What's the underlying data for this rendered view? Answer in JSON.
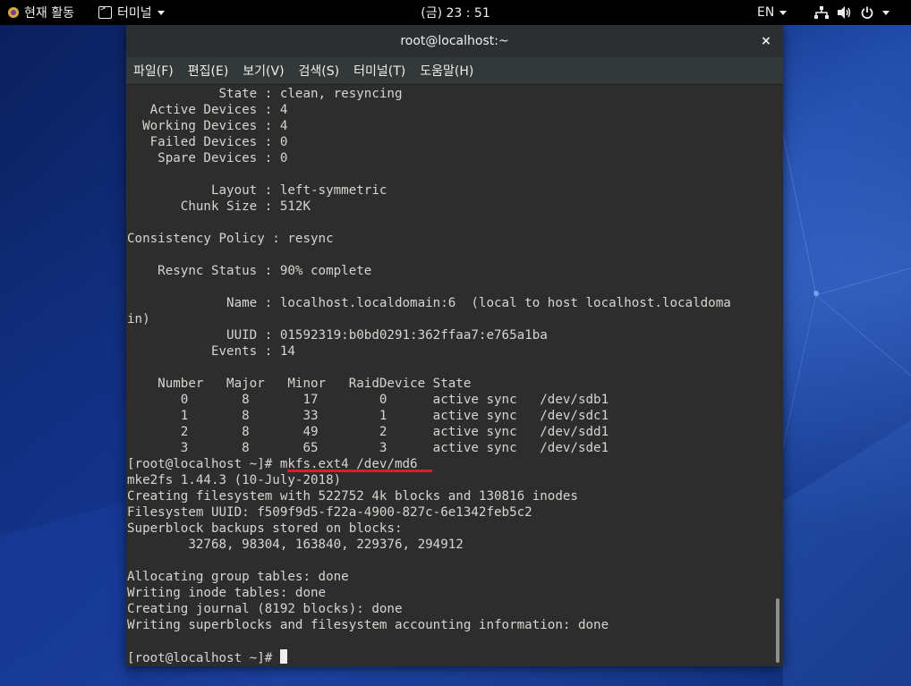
{
  "topbar": {
    "activities_label": "현재 활동",
    "app_menu_label": "터미널",
    "clock": "(금) 23 : 51",
    "input_method": "EN"
  },
  "window": {
    "title": "root@localhost:~",
    "close_symbol": "×"
  },
  "menu": [
    {
      "label": "파일(F)"
    },
    {
      "label": "편집(E)"
    },
    {
      "label": "보기(V)"
    },
    {
      "label": "검색(S)"
    },
    {
      "label": "터미널(T)"
    },
    {
      "label": "도움말(H)"
    }
  ],
  "terminal": {
    "lines": [
      "            State : clean, resyncing",
      "   Active Devices : 4",
      "  Working Devices : 4",
      "   Failed Devices : 0",
      "    Spare Devices : 0",
      "",
      "           Layout : left-symmetric",
      "       Chunk Size : 512K",
      "",
      "Consistency Policy : resync",
      "",
      "    Resync Status : 90% complete",
      "",
      "             Name : localhost.localdomain:6  (local to host localhost.localdoma",
      "in)",
      "             UUID : 01592319:b0bd0291:362ffaa7:e765a1ba",
      "           Events : 14",
      "",
      "    Number   Major   Minor   RaidDevice State",
      "       0       8       17        0      active sync   /dev/sdb1",
      "       1       8       33        1      active sync   /dev/sdc1",
      "       2       8       49        2      active sync   /dev/sdd1",
      "       3       8       65        3      active sync   /dev/sde1",
      "[root@localhost ~]# mkfs.ext4 /dev/md6",
      "mke2fs 1.44.3 (10-July-2018)",
      "Creating filesystem with 522752 4k blocks and 130816 inodes",
      "Filesystem UUID: f509f9d5-f22a-4900-827c-6e1342feb5c2",
      "Superblock backups stored on blocks:",
      "        32768, 98304, 163840, 229376, 294912",
      "",
      "Allocating group tables: done",
      "Writing inode tables: done",
      "Creating journal (8192 blocks): done",
      "Writing superblocks and filesystem accounting information: done",
      ""
    ],
    "prompt": "[root@localhost ~]# "
  },
  "icons": {
    "activities": "fedora-logo-icon",
    "app_menu": "terminal-icon",
    "network": "network-icon",
    "volume": "volume-icon",
    "power": "power-icon"
  },
  "colors": {
    "terminal_bg": "#2d2d2d",
    "terminal_fg": "#d3d7cf",
    "highlight_underline": "#e01b24",
    "topbar_bg": "#000000"
  }
}
